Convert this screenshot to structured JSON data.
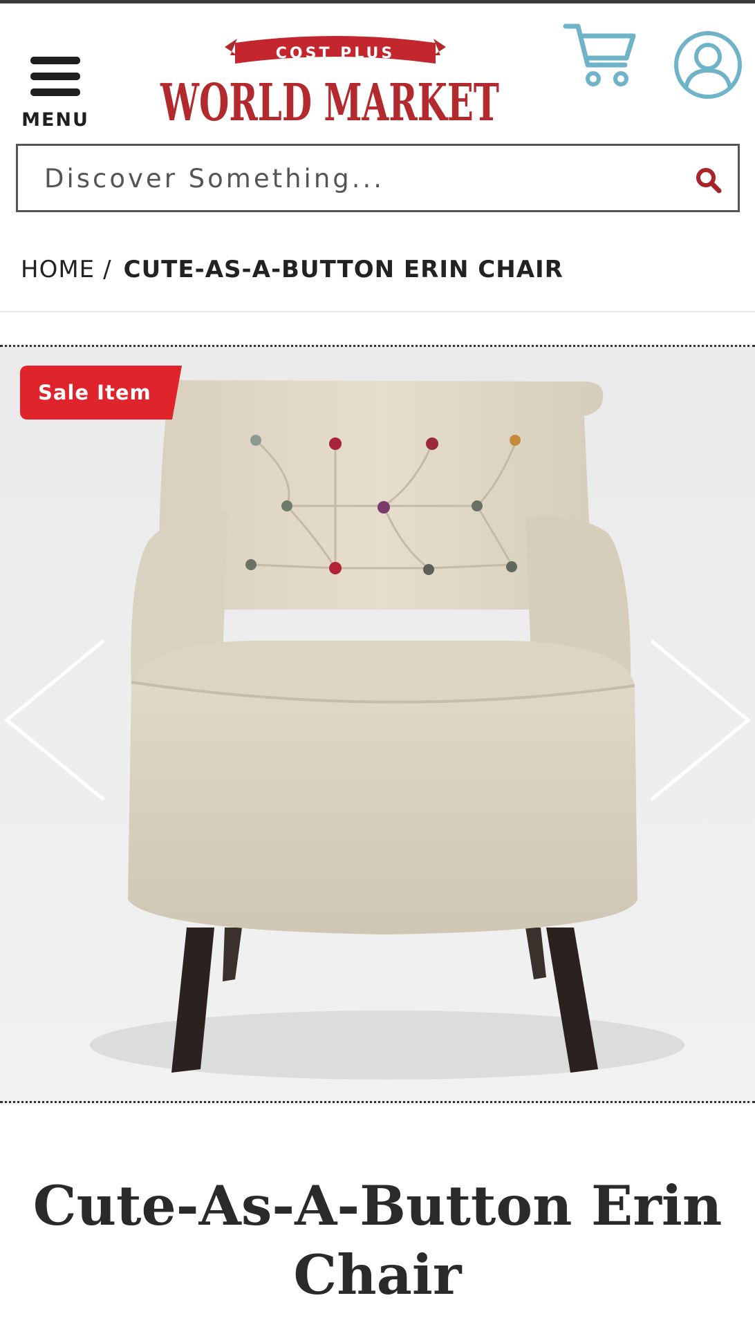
{
  "header": {
    "menu_label": "MENU",
    "logo": {
      "banner_text": "COST PLUS",
      "brand_text": "WORLD MARKET",
      "brand_color": "#b22a2e"
    },
    "icons": {
      "menu": "hamburger-icon",
      "cart": "shopping-cart-icon",
      "account": "user-account-icon"
    },
    "icon_color": "#6fb3c9"
  },
  "search": {
    "placeholder": "Discover Something...",
    "icon": "search-icon"
  },
  "breadcrumb": {
    "home": "HOME",
    "separator": "/",
    "current": "CUTE-AS-A-BUTTON ERIN CHAIR"
  },
  "gallery": {
    "badge": "Sale Item",
    "badge_color": "#e0242b",
    "image_alt": "Cute-As-A-Button Erin Chair",
    "prev_icon": "chevron-left-icon",
    "next_icon": "chevron-right-icon"
  },
  "product": {
    "title": "Cute-As-A-Button Erin Chair"
  }
}
